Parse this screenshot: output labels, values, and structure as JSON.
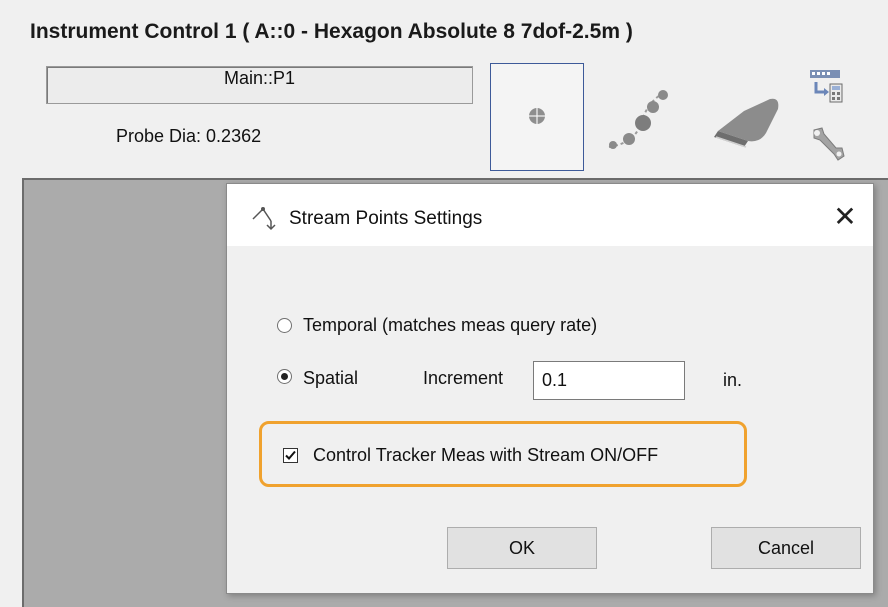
{
  "panel": {
    "title": "Instrument Control 1 ( A::0 - Hexagon Absolute 8 7dof-2.5m )",
    "probe_name": "Main::P1",
    "probe_dia": "Probe Dia: 0.2362",
    "tools": [
      {
        "name": "single-point-icon",
        "selected": true
      },
      {
        "name": "stream-points-icon",
        "selected": false
      },
      {
        "name": "scanner-icon",
        "selected": false
      }
    ],
    "side_icons": [
      "calculator-transfer-icon",
      "wrench-icon"
    ]
  },
  "dialog": {
    "title": "Stream Points Settings",
    "close_glyph": "✕",
    "temporal_label": "Temporal (matches meas query rate)",
    "temporal_checked": false,
    "spatial_label": "Spatial",
    "spatial_checked": true,
    "increment_label": "Increment",
    "increment_value": "0.1",
    "unit": "in.",
    "control_tracker_label": "Control Tracker Meas with Stream ON/OFF",
    "control_tracker_checked": true,
    "ok_label": "OK",
    "cancel_label": "Cancel"
  },
  "colors": {
    "highlight": "#f0a22e",
    "selected_tool_border": "#3d5a99",
    "workspace": "#ababab"
  }
}
